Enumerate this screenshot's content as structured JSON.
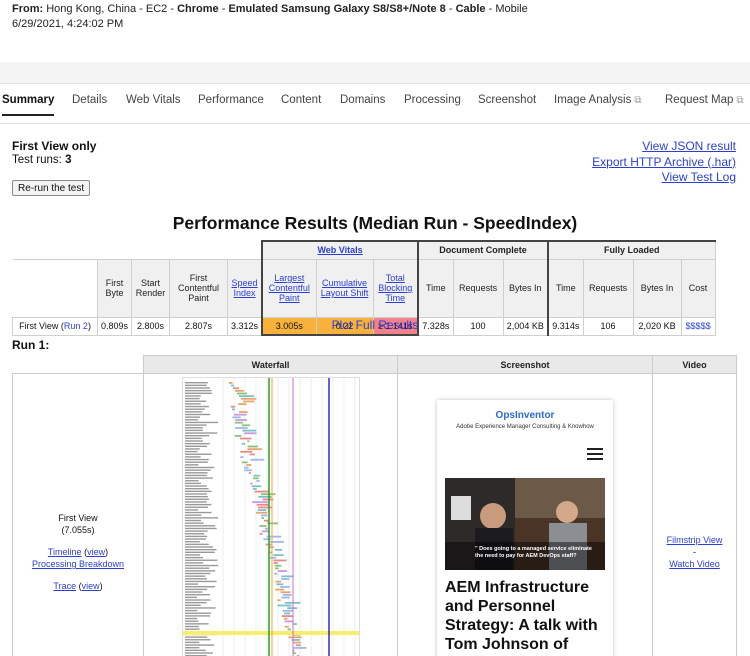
{
  "header": {
    "from_label": "From:",
    "from_location": "Hong Kong, China - EC2",
    "browser": "Chrome",
    "device": "Emulated Samsung Galaxy S8/S8+/Note 8",
    "connection": "Cable",
    "mode": "Mobile",
    "sep": " - ",
    "timestamp": "6/29/2021, 4:24:02 PM"
  },
  "tabs": [
    {
      "label": "Summary",
      "active": true
    },
    {
      "label": "Details"
    },
    {
      "label": "Web Vitals"
    },
    {
      "label": "Performance"
    },
    {
      "label": "Content"
    },
    {
      "label": "Domains"
    },
    {
      "label": "Processing"
    },
    {
      "label": "Screenshot"
    },
    {
      "label": "Image Analysis",
      "external": true
    },
    {
      "label": "Request Map",
      "external": true
    }
  ],
  "summary": {
    "title": "First View only",
    "runs_label": "Test runs:",
    "runs_value": "3",
    "rerun_button": "Re-run the test",
    "links": [
      "View JSON result",
      "Export HTTP Archive (.har)",
      "View Test Log"
    ]
  },
  "performance": {
    "title": "Performance Results (Median Run - SpeedIndex)",
    "group_headers": {
      "web_vitals": "Web Vitals",
      "document_complete": "Document Complete",
      "fully_loaded": "Fully Loaded"
    },
    "columns": {
      "first_byte": "First Byte",
      "start_render": "Start Render",
      "fcp": "First Contentful Paint",
      "speed_index": "Speed Index",
      "lcp": "Largest Contentful Paint",
      "cls": "Cumulative Layout Shift",
      "tbt": "Total Blocking Time",
      "time": "Time",
      "requests": "Requests",
      "bytes_in": "Bytes In",
      "cost": "Cost"
    },
    "row": {
      "label": "First View (",
      "run_link": "Run 2",
      "label_end": ")",
      "first_byte": "0.809s",
      "start_render": "2.800s",
      "fcp": "2.807s",
      "speed_index": "3.312s",
      "lcp": "3.005s",
      "cls": "0.22",
      "tbt": "≥ 1.141s",
      "dc_time": "7.328s",
      "dc_requests": "100",
      "dc_bytes": "2,004 KB",
      "fl_time": "9.314s",
      "fl_requests": "106",
      "fl_bytes": "2,020 KB",
      "cost": "$$$$$"
    },
    "plot_full": "Plot Full Results"
  },
  "run1": {
    "title": "Run 1:",
    "headers": {
      "waterfall": "Waterfall",
      "screenshot": "Screenshot",
      "video": "Video"
    },
    "first_view": "First View",
    "first_view_time": "(7.055s)",
    "timeline": "Timeline",
    "view": "view",
    "processing_breakdown": "Processing Breakdown",
    "trace": "Trace",
    "filmstrip": "Filmstrip View",
    "dash": "-",
    "watch_video": "Watch Video"
  },
  "screenshot_content": {
    "brand": "OpsInventor",
    "tagline": "Adobe Experience Manager Consulting & Knowhow",
    "hero_quote": "\" Does going to a managed service eliminate the need to pay for AEM DevOps staff?",
    "article_title": "AEM Infrastructure and Personnel Strategy: A talk with Tom Johnson of Hirobe"
  },
  "colors": {
    "link": "#2a3fd6",
    "lcp_bg": "#f8b13a",
    "tbt_bg": "#f3808a",
    "brand": "#2a6bd6"
  }
}
